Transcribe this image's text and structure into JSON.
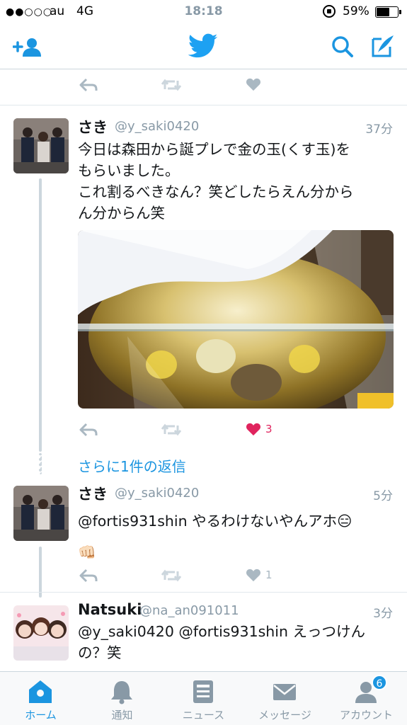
{
  "status_bar": {
    "signal": "●●○○○",
    "carrier": "au",
    "network": "4G",
    "time": "18:18",
    "battery_percent": "59%",
    "battery_level": 0.59
  },
  "nav": {
    "add_user_icon": "add-user-icon",
    "logo_icon": "twitter-bird-icon",
    "search_icon": "search-icon",
    "compose_icon": "compose-icon"
  },
  "tweets": [
    {
      "name": "さき",
      "handle": "@y_saki0420",
      "time": "37分",
      "lines": [
        "今日は森田から誕プレで金の玉(くす玉)を",
        "もらいました。",
        "これ割るべきなん？笑どしたらえん分から",
        "ん分からん笑"
      ],
      "likes": "3"
    },
    {
      "name": "さき",
      "handle": "@y_saki0420",
      "time": "5分",
      "lines": [
        "@fortis931shin やるわけないやんアホ😑",
        "👊🏻"
      ],
      "likes": "1"
    },
    {
      "name": "Natsuki",
      "handle": "@na_an091011",
      "time": "3分",
      "lines": [
        "@y_saki0420 @fortis931shin えっつけん",
        "の？笑"
      ]
    }
  ],
  "more_replies": "さらに1件の返信",
  "tabs": [
    {
      "label": "ホーム",
      "icon": "home-icon"
    },
    {
      "label": "通知",
      "icon": "bell-icon"
    },
    {
      "label": "ニュース",
      "icon": "news-icon"
    },
    {
      "label": "メッセージ",
      "icon": "envelope-icon"
    },
    {
      "label": "アカウント",
      "icon": "person-icon"
    }
  ],
  "account_badge": "6",
  "colors": {
    "accent": "#1b95e0",
    "like_red": "#e0245e",
    "gray": "#8899a6"
  }
}
